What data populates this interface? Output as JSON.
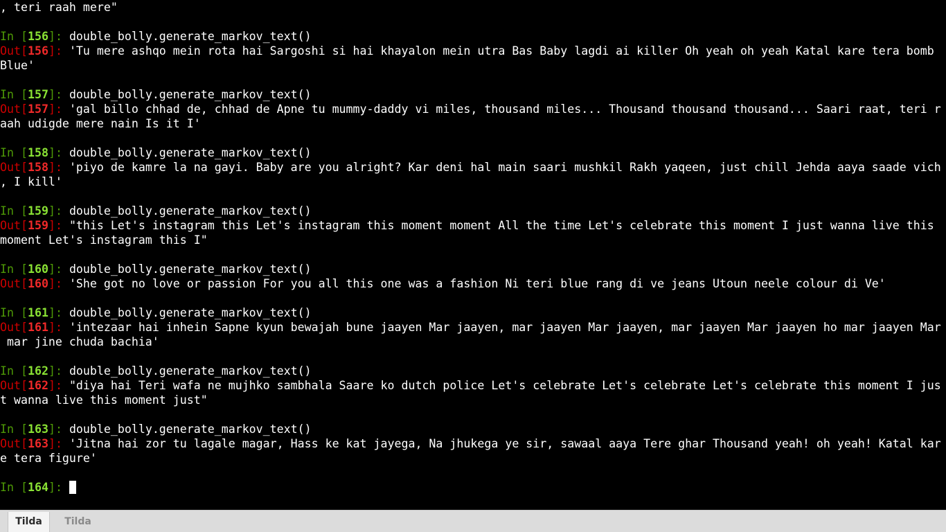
{
  "terminal": {
    "background": "#000000",
    "colors": {
      "text": "#ffffff",
      "in_prompt": "#4e9a06",
      "in_number": "#8ae234",
      "out_prompt": "#cc0000",
      "out_number": "#ef2929"
    },
    "leading_output": [
      ", teri raah mere\""
    ],
    "cells": [
      {
        "in_number": "156",
        "input": "double_bolly.generate_markov_text()",
        "out_number": "156",
        "output_lines": [
          "'Tu mere ashqo mein rota hai Sargoshi si hai khayalon mein utra Bas Baby lagdi ai killer Oh yeah oh yeah Katal kare tera bomb",
          "Blue'"
        ]
      },
      {
        "in_number": "157",
        "input": "double_bolly.generate_markov_text()",
        "out_number": "157",
        "output_lines": [
          "'gal billo chhad de, chhad de Apne tu mummy-daddy vi miles, thousand miles... Thousand thousand thousand... Saari raat, teri r",
          "aah udigde mere nain Is it I'"
        ]
      },
      {
        "in_number": "158",
        "input": "double_bolly.generate_markov_text()",
        "out_number": "158",
        "output_lines": [
          "'piyo de kamre la na gayi. Baby are you alright? Kar deni hal main saari mushkil Rakh yaqeen, just chill Jehda aaya saade vich",
          ", I kill'"
        ]
      },
      {
        "in_number": "159",
        "input": "double_bolly.generate_markov_text()",
        "out_number": "159",
        "output_lines": [
          "\"this Let's instagram this Let's instagram this moment moment All the time Let's celebrate this moment I just wanna live this",
          "moment Let's instagram this I\""
        ]
      },
      {
        "in_number": "160",
        "input": "double_bolly.generate_markov_text()",
        "out_number": "160",
        "output_lines": [
          "'She got no love or passion For you all this one was a fashion Ni teri blue rang di ve jeans Utoun neele colour di Ve'"
        ]
      },
      {
        "in_number": "161",
        "input": "double_bolly.generate_markov_text()",
        "out_number": "161",
        "output_lines": [
          "'intezaar hai inhein Sapne kyun bewajah bune jaayen Mar jaayen, mar jaayen Mar jaayen, mar jaayen Mar jaayen ho mar jaayen Mar",
          " mar jine chuda bachia'"
        ]
      },
      {
        "in_number": "162",
        "input": "double_bolly.generate_markov_text()",
        "out_number": "162",
        "output_lines": [
          "\"diya hai Teri wafa ne mujhko sambhala Saare ko dutch police Let's celebrate Let's celebrate Let's celebrate this moment I jus",
          "t wanna live this moment just\""
        ]
      },
      {
        "in_number": "163",
        "input": "double_bolly.generate_markov_text()",
        "out_number": "163",
        "output_lines": [
          "'Jitna hai zor tu lagale magar, Hass ke kat jayega, Na jhukega ye sir, sawaal aaya Tere ghar Thousand yeah! oh yeah! Katal kar",
          "e tera figure'"
        ]
      }
    ],
    "current_prompt": {
      "in_number": "164",
      "input": ""
    }
  },
  "prompt_parts": {
    "in_label": "In [",
    "out_label": "Out[",
    "close": "]: "
  },
  "tabs": [
    {
      "label": "Tilda",
      "active": true
    },
    {
      "label": "Tilda",
      "active": false
    }
  ]
}
